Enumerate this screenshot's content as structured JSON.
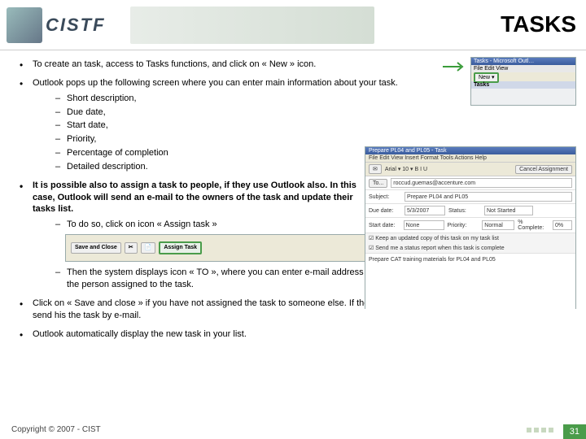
{
  "header": {
    "logo_text": "CISTF",
    "title": "TASKS"
  },
  "bullets": [
    {
      "text": "To create an task, access to Tasks functions, and click on « New » icon."
    },
    {
      "text": "Outlook pops up the following screen where you can enter main information about your task.",
      "sub": [
        "Short description,",
        "Due date,",
        "Start date,",
        "Priority,",
        "Percentage of completion",
        "Detailed description."
      ]
    },
    {
      "bold": true,
      "text": "It is possible also to assign a task to people, if they use Outlook also. In this case, Outlook will send an e-mail to the owners of the task and update their tasks list.",
      "narrow": true,
      "sub": [
        "To do so, click on icon « Assign task »"
      ],
      "sub2": [
        "Then the system displays icon « TO », where you can enter e-mail address of the person assigned to the task."
      ]
    },
    {
      "text": "Click on « Save and close » if you have not assigned the task to someone else. If the task is assigned to a person, click on « Send » to send his the task by e-mail."
    },
    {
      "text": "Outlook automatically display the new task in your list."
    }
  ],
  "thumb": {
    "title": "Tasks - Microsoft Outl…",
    "bar2": "File Edit View",
    "label": "Tasks",
    "new_btn": "New ▾"
  },
  "task_window": {
    "title": "Prepare PL04 and PL05 - Task",
    "menu": "File  Edit  View  Insert  Format  Tools  Actions  Help",
    "fields": {
      "to_label": "To...",
      "to_value": "roccud.guemas@accenture.com",
      "subject_label": "Subject:",
      "subject_value": "Prepare PL04 and PL05",
      "due_label": "Due date:",
      "due_value": "5/3/2007",
      "status_label": "Status:",
      "status_value": "Not Started",
      "start_label": "Start date:",
      "start_value": "None",
      "priority_label": "Priority:",
      "priority_value": "Normal",
      "complete_label": "% Complete:",
      "complete_value": "0%"
    },
    "checks": [
      "Keep an updated copy of this task on my task list",
      "Send me a status report when this task is complete"
    ],
    "body": "Prepare CAT training materials for PL04 and PL05"
  },
  "assign_toolbar": {
    "save": "Save and Close",
    "assign": "Assign Task"
  },
  "footer": {
    "copyright": "Copyright © 2007 - CIST",
    "page": "31"
  }
}
